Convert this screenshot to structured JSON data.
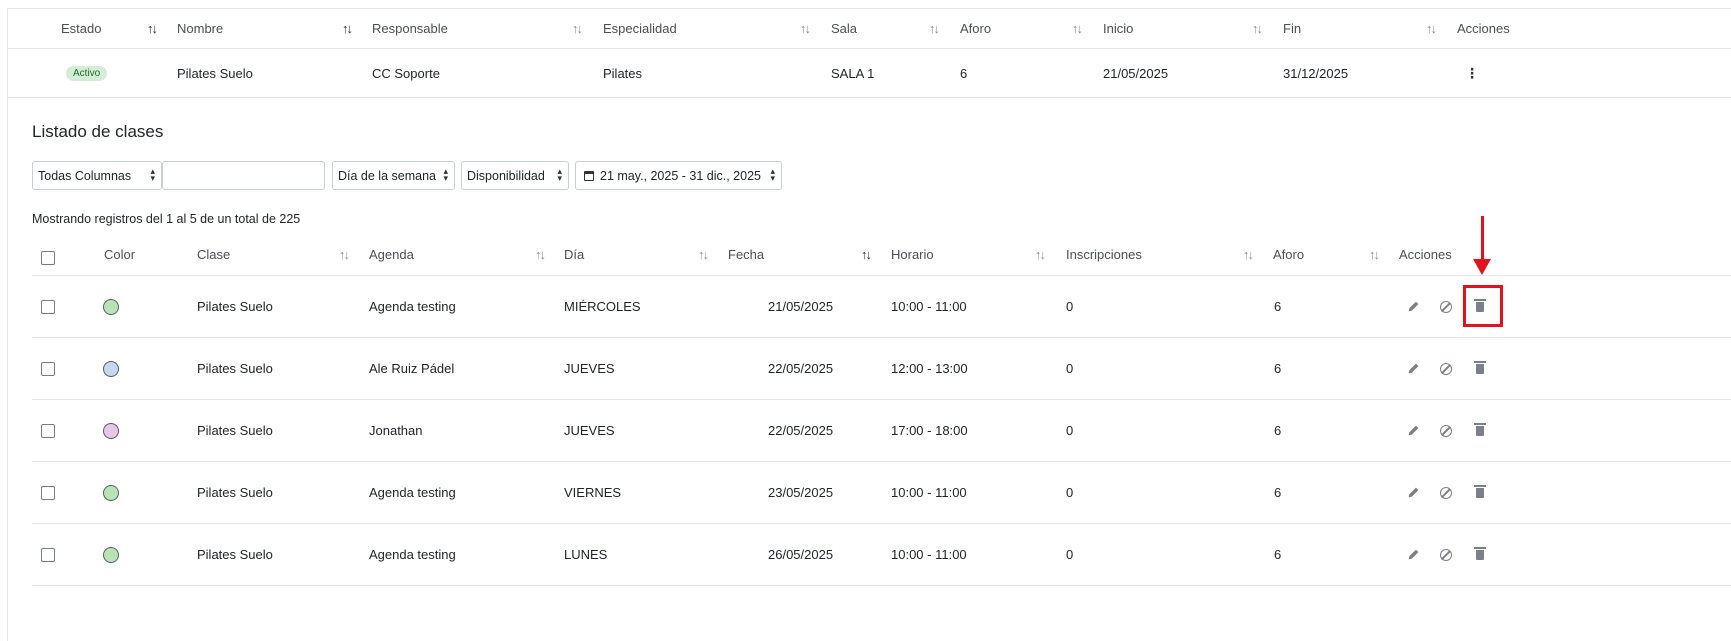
{
  "top_table": {
    "headers": [
      "Estado",
      "Nombre",
      "Responsable",
      "Especialidad",
      "Sala",
      "Aforo",
      "Inicio",
      "Fin",
      "Acciones"
    ],
    "row": {
      "estado": "Activo",
      "nombre": "Pilates Suelo",
      "responsable": "CC Soporte",
      "especialidad": "Pilates",
      "sala": "SALA 1",
      "aforo": "6",
      "inicio": "21/05/2025",
      "fin": "31/12/2025",
      "acciones_icon": "⋮"
    },
    "badge_color": "#d4edd5"
  },
  "section": {
    "title": "Listado de clases"
  },
  "filters": {
    "columns_select": "Todas Columnas",
    "search_value": "",
    "weekday_select": "Día de la semana",
    "availability_select": "Disponibilidad",
    "date_range": "21 may., 2025 - 31 dic., 2025"
  },
  "info_text": "Mostrando registros del 1 al 5 de un total de 225",
  "classes_table": {
    "headers": [
      "Color",
      "Clase",
      "Agenda",
      "Día",
      "Fecha",
      "Horario",
      "Inscripciones",
      "Aforo",
      "Acciones"
    ],
    "rows": [
      {
        "color": "#b9e3b5",
        "clase": "Pilates Suelo",
        "agenda": "Agenda testing",
        "dia": "MIÉRCOLES",
        "fecha": "21/05/2025",
        "horario": "10:00 - 11:00",
        "inscripciones": "0",
        "aforo": "6"
      },
      {
        "color": "#c3d8f3",
        "clase": "Pilates Suelo",
        "agenda": "Ale Ruiz Pádel",
        "dia": "JUEVES",
        "fecha": "22/05/2025",
        "horario": "12:00 - 13:00",
        "inscripciones": "0",
        "aforo": "6"
      },
      {
        "color": "#e8c6e6",
        "clase": "Pilates Suelo",
        "agenda": "Jonathan",
        "dia": "JUEVES",
        "fecha": "22/05/2025",
        "horario": "17:00 - 18:00",
        "inscripciones": "0",
        "aforo": "6"
      },
      {
        "color": "#b9e3b5",
        "clase": "Pilates Suelo",
        "agenda": "Agenda testing",
        "dia": "VIERNES",
        "fecha": "23/05/2025",
        "horario": "10:00 - 11:00",
        "inscripciones": "0",
        "aforo": "6"
      },
      {
        "color": "#b9e3b5",
        "clase": "Pilates Suelo",
        "agenda": "Agenda testing",
        "dia": "LUNES",
        "fecha": "26/05/2025",
        "horario": "10:00 - 11:00",
        "inscripciones": "0",
        "aforo": "6"
      }
    ]
  },
  "icons": {
    "sort": "sort-arrows-icon",
    "edit": "pencil-icon",
    "cancel": "ban-icon",
    "delete": "trash-icon"
  },
  "annotation_color": "#e0141e"
}
